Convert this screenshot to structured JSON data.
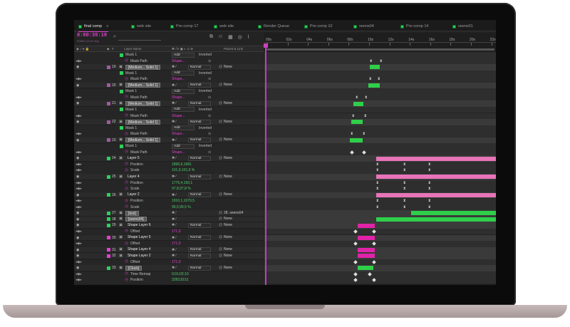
{
  "tabs": [
    {
      "label": "final comp",
      "active": true
    },
    {
      "label": "web site"
    },
    {
      "label": "Pre-comp 17"
    },
    {
      "label": "web site"
    },
    {
      "label": "Render Queue"
    },
    {
      "label": "Pre-comp 10"
    },
    {
      "label": "seens04"
    },
    {
      "label": "Pre-comp 14"
    },
    {
      "label": "seens01"
    }
  ],
  "timecode": "0:00:35:19",
  "fps": "00859 (24.00 fps)",
  "column_headers": {
    "layer_name": "Layer Name",
    "parent": "Parent & Link"
  },
  "ruler_labels": [
    "00s",
    "02s",
    "04s",
    "06s",
    "08s",
    "10s",
    "12s",
    "14s",
    "16s",
    "18s",
    "20s",
    "22s"
  ],
  "rows": [
    {
      "type": "prop",
      "indent": 2,
      "text": "Mask 1",
      "mode": "Add",
      "inverted": "Inverted",
      "label_color": "#2fcf5a"
    },
    {
      "type": "prop",
      "indent": 3,
      "text": "Mask Path",
      "value": "Shape...",
      "value_color": "magenta",
      "sw": true
    },
    {
      "type": "layer",
      "num": "19",
      "name": "[Medium... Solid 1]",
      "mode": "Normal",
      "parent": "None",
      "label_color": "#a05aa0",
      "bar": {
        "color": "green"
      }
    },
    {
      "type": "prop",
      "indent": 2,
      "text": "Mask 1",
      "mode": "Add",
      "inverted": "Inverted",
      "label_color": "#2fcf5a"
    },
    {
      "type": "prop",
      "indent": 3,
      "text": "Mask Path",
      "value": "Shape...",
      "value_color": "magenta",
      "sw": true
    },
    {
      "type": "layer",
      "num": "20",
      "name": "[Medium... Solid 1]",
      "mode": "Normal",
      "parent": "None",
      "label_color": "#a05aa0",
      "bar": {
        "color": "green"
      }
    },
    {
      "type": "prop",
      "indent": 2,
      "text": "Mask 1",
      "mode": "Add",
      "inverted": "Inverted",
      "label_color": "#2fcf5a"
    },
    {
      "type": "prop",
      "indent": 3,
      "text": "Mask Path",
      "value": "Shape...",
      "value_color": "magenta",
      "sw": true
    },
    {
      "type": "layer",
      "num": "21",
      "name": "[Medium... Solid 1]",
      "mode": "Normal",
      "parent": "None",
      "label_color": "#a05aa0",
      "bar": {
        "color": "green"
      }
    },
    {
      "type": "prop",
      "indent": 2,
      "text": "Mask 1",
      "mode": "Add",
      "inverted": "Inverted",
      "label_color": "#2fcf5a"
    },
    {
      "type": "prop",
      "indent": 3,
      "text": "Mask Path",
      "value": "Shape...",
      "value_color": "magenta",
      "sw": true
    },
    {
      "type": "layer",
      "num": "22",
      "name": "[Medium... Solid 1]",
      "mode": "Normal",
      "parent": "None",
      "label_color": "#a05aa0",
      "bar": {
        "color": "green"
      }
    },
    {
      "type": "prop",
      "indent": 2,
      "text": "Mask 1",
      "mode": "Add",
      "inverted": "Inverted",
      "label_color": "#2fcf5a"
    },
    {
      "type": "prop",
      "indent": 3,
      "text": "Mask Path",
      "value": "Shape...",
      "value_color": "magenta",
      "sw": true
    },
    {
      "type": "layer",
      "num": "23",
      "name": "[Medium... Solid 1]",
      "mode": "Normal",
      "parent": "None",
      "label_color": "#a05aa0",
      "bar": {
        "color": "green"
      }
    },
    {
      "type": "prop",
      "indent": 2,
      "text": "Mask 1",
      "mode": "Add",
      "inverted": "Inverted",
      "label_color": "#2fcf5a"
    },
    {
      "type": "prop",
      "indent": 3,
      "text": "Mask Path",
      "value": "Shape...",
      "value_color": "magenta",
      "sw": true
    },
    {
      "type": "layer",
      "num": "24",
      "name": "Layer 5",
      "mode": "Normal",
      "parent": "None",
      "label_color": "#2fcf5a",
      "bar": {
        "color": "pink"
      }
    },
    {
      "type": "prop",
      "indent": 3,
      "text": "Position",
      "value": "1896,6,1681",
      "value_color": "green"
    },
    {
      "type": "prop",
      "indent": 3,
      "text": "Scale",
      "value": "101,9,101,9 %",
      "value_color": "green"
    },
    {
      "type": "layer",
      "num": "25",
      "name": "Layer 4",
      "mode": "Normal",
      "parent": "None",
      "label_color": "#2fcf5a",
      "bar": {
        "color": "pink"
      }
    },
    {
      "type": "prop",
      "indent": 3,
      "text": "Position",
      "value": "1776,4,150,1",
      "value_color": "green"
    },
    {
      "type": "prop",
      "indent": 3,
      "text": "Scale",
      "value": "97,8,97,8 %",
      "value_color": "green"
    },
    {
      "type": "layer",
      "num": "26",
      "name": "Layer 2",
      "mode": "Normal",
      "parent": "None",
      "label_color": "#2fcf5a",
      "bar": {
        "color": "pink"
      }
    },
    {
      "type": "prop",
      "indent": 3,
      "text": "Position",
      "value": "1910,1,1070,5",
      "value_color": "green"
    },
    {
      "type": "prop",
      "indent": 3,
      "text": "Scale",
      "value": "99,5,99,5 %",
      "value_color": "green"
    },
    {
      "type": "layer",
      "num": "27",
      "name": "[text]",
      "mode": "",
      "parent": "28. seens04",
      "label_color": "#2fcf5a",
      "bar": {
        "color": "green"
      }
    },
    {
      "type": "layer",
      "num": "28",
      "name": "[seens04]",
      "mode": "",
      "parent": "None",
      "label_color": "#2fcf5a",
      "bar": {
        "color": "green"
      }
    },
    {
      "type": "layer",
      "num": "29",
      "name": "Shape Layer 6",
      "mode": "Normal",
      "parent": "None",
      "label_color": "#2fcf5a",
      "bar": {
        "color": "magenta"
      }
    },
    {
      "type": "prop",
      "indent": 3,
      "text": "Offset",
      "value": "171,0",
      "value_color": "magenta"
    },
    {
      "type": "layer",
      "num": "30",
      "name": "Shape Layer 5",
      "mode": "Normal",
      "parent": "None",
      "label_color": "#e040d0",
      "bar": {
        "color": "magenta"
      }
    },
    {
      "type": "prop",
      "indent": 3,
      "text": "Offset",
      "value": "171,0",
      "value_color": "magenta"
    },
    {
      "type": "layer",
      "num": "31",
      "name": "Shape Layer 4",
      "mode": "Normal",
      "parent": "None",
      "label_color": "#e040d0",
      "bar": {
        "color": "magenta"
      }
    },
    {
      "type": "layer",
      "num": "32",
      "name": "Shape Layer 2",
      "mode": "Normal",
      "parent": "None",
      "label_color": "#e040d0",
      "bar": {
        "color": "magenta"
      }
    },
    {
      "type": "prop",
      "indent": 3,
      "text": "Offset",
      "value": "171,0",
      "value_color": "magenta"
    },
    {
      "type": "layer",
      "num": "33",
      "name": "[Clock]",
      "mode": "Normal",
      "parent": "None",
      "label_color": "#2fcf5a",
      "bar": {
        "color": "green"
      }
    },
    {
      "type": "prop",
      "indent": 3,
      "text": "Time Remap",
      "value": "0;01;02;10",
      "value_color": "green"
    },
    {
      "type": "prop",
      "indent": 3,
      "text": "Position",
      "value": "3283,8151",
      "value_color": "green"
    }
  ]
}
